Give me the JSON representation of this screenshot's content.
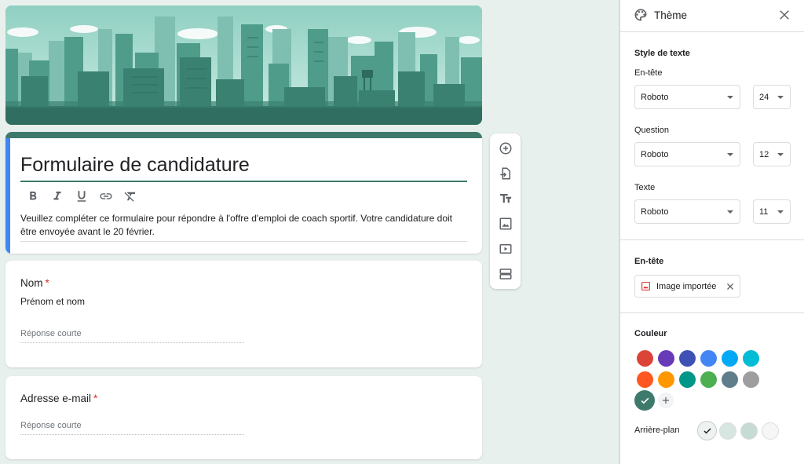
{
  "form": {
    "title": "Formulaire de candidature",
    "description": "Veuillez compléter ce formulaire pour répondre à l'offre d'emploi de coach sportif. Votre candidature doit être envoyée avant le 20 février."
  },
  "questions": [
    {
      "title": "Nom",
      "required_mark": "*",
      "description": "Prénom et nom",
      "placeholder": "Réponse courte"
    },
    {
      "title": "Adresse e-mail",
      "required_mark": "*",
      "placeholder": "Réponse courte"
    }
  ],
  "format_toolbar": [
    "bold-icon",
    "italic-icon",
    "underline-icon",
    "link-icon",
    "clear-format-icon"
  ],
  "floating_toolbar": [
    "add-question-icon",
    "import-questions-icon",
    "add-title-icon",
    "add-image-icon",
    "add-video-icon",
    "add-section-icon"
  ],
  "theme_panel": {
    "title": "Thème",
    "text_style": {
      "section_title": "Style de texte",
      "header": {
        "label": "En-tête",
        "font": "Roboto",
        "size": "24"
      },
      "question": {
        "label": "Question",
        "font": "Roboto",
        "size": "12"
      },
      "text": {
        "label": "Texte",
        "font": "Roboto",
        "size": "11"
      }
    },
    "header_section": {
      "title": "En-tête",
      "chip_label": "Image importée"
    },
    "color_section": {
      "title": "Couleur",
      "colors": [
        "#db4437",
        "#673ab7",
        "#3f51b5",
        "#4285f4",
        "#03a9f4",
        "#00bcd4",
        "#ff5722",
        "#ff9800",
        "#009688",
        "#4caf50",
        "#607d8b",
        "#9e9e9e"
      ],
      "selected_color": "#3e7a6b",
      "background_label": "Arrière-plan",
      "background_colors": [
        "#eef2f0",
        "#d8e6e1",
        "#c5dbd4",
        "#f6f6f6"
      ]
    }
  }
}
